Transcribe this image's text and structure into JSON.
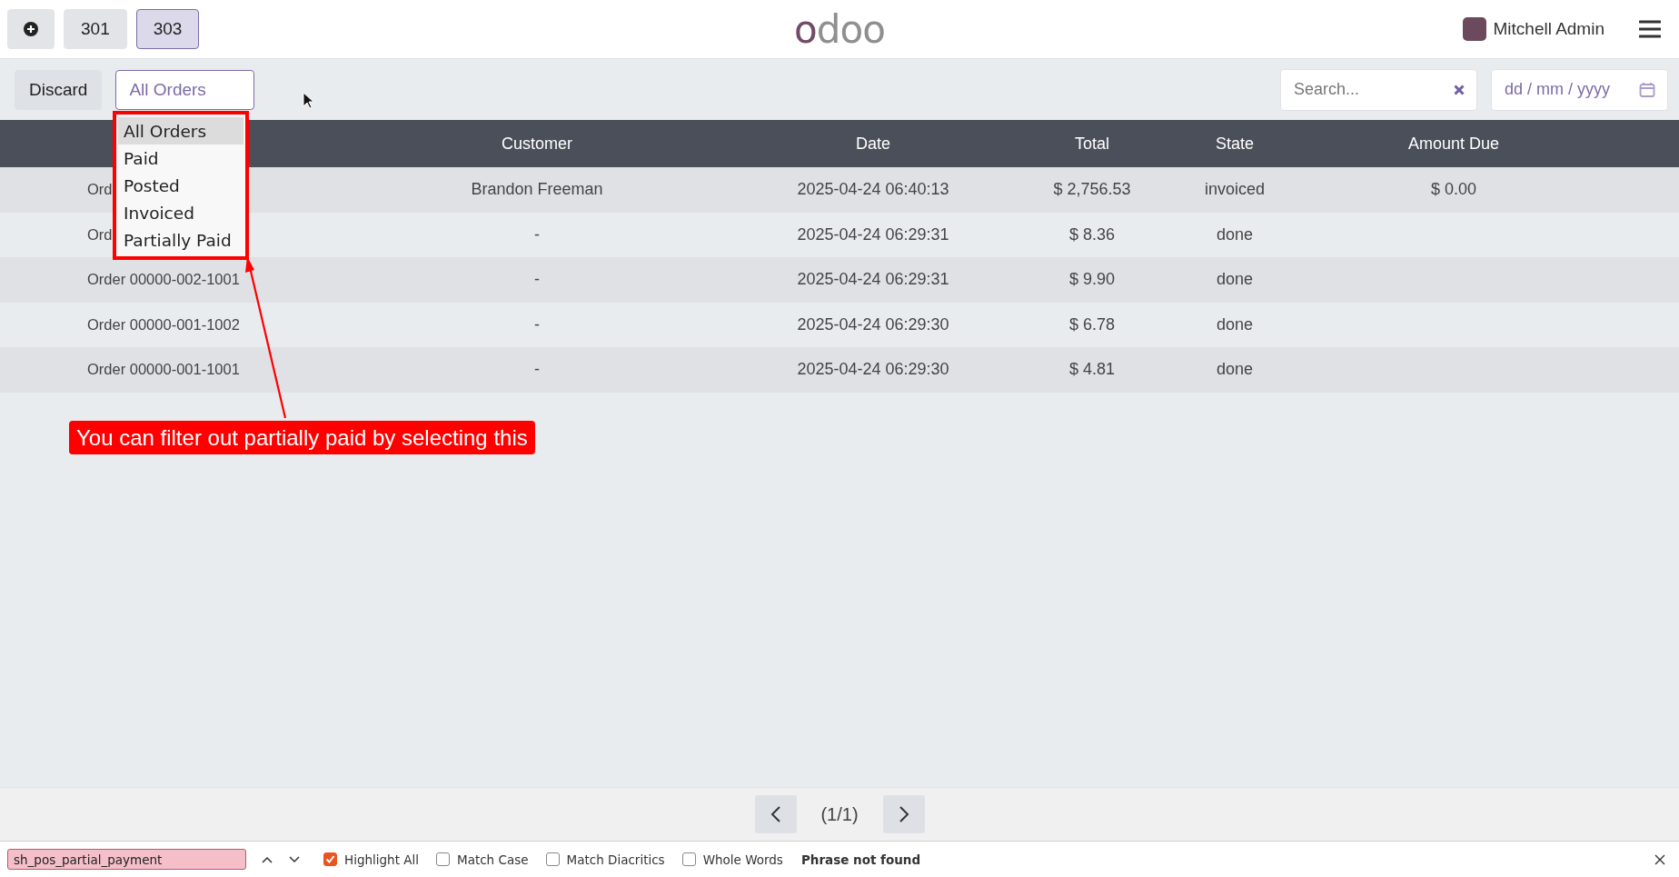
{
  "top_bar": {
    "order_tabs": [
      {
        "label": "301",
        "selected": false
      },
      {
        "label": "303",
        "selected": true
      }
    ],
    "logo": "odoo",
    "user": {
      "name": "Mitchell Admin"
    }
  },
  "toolbar": {
    "discard": "Discard",
    "filter": {
      "value": "All Orders",
      "expanded": true,
      "options": [
        {
          "label": "All Orders",
          "selected": true
        },
        {
          "label": "Paid",
          "selected": false
        },
        {
          "label": "Posted",
          "selected": false
        },
        {
          "label": "Invoiced",
          "selected": false
        },
        {
          "label": "Partially Paid",
          "selected": false
        }
      ]
    },
    "search": {
      "placeholder": "Search..."
    },
    "date": {
      "placeholder": "dd / mm / yyyy"
    }
  },
  "table": {
    "columns": [
      "Customer",
      "Date",
      "Total",
      "State",
      "Amount Due"
    ],
    "rows": [
      {
        "order": "Ord",
        "customer": "Brandon Freeman",
        "date": "2025-04-24 06:40:13",
        "total": "$ 2,756.53",
        "state": "invoiced",
        "amount_due": "$ 0.00"
      },
      {
        "order": "Ord",
        "customer": "-",
        "date": "2025-04-24 06:29:31",
        "total": "$ 8.36",
        "state": "done"
      },
      {
        "order": "Order 00000-002-1001",
        "customer": "-",
        "date": "2025-04-24 06:29:31",
        "total": "$ 9.90",
        "state": "done"
      },
      {
        "order": "Order 00000-001-1002",
        "customer": "-",
        "date": "2025-04-24 06:29:30",
        "total": "$ 6.78",
        "state": "done"
      },
      {
        "order": "Order 00000-001-1001",
        "customer": "-",
        "date": "2025-04-24 06:29:30",
        "total": "$ 4.81",
        "state": "done"
      }
    ]
  },
  "annotation": {
    "text": "You can filter out partially paid by selecting this"
  },
  "pager": {
    "label": "(1/1)"
  },
  "find_bar": {
    "query": "sh_pos_partial_payment",
    "not_found": true,
    "options": [
      {
        "label": "Highlight All",
        "checked": true
      },
      {
        "label": "Match Case",
        "checked": false
      },
      {
        "label": "Match Diacritics",
        "checked": false
      },
      {
        "label": "Whole Words",
        "checked": false
      }
    ],
    "status": "Phrase not found"
  }
}
